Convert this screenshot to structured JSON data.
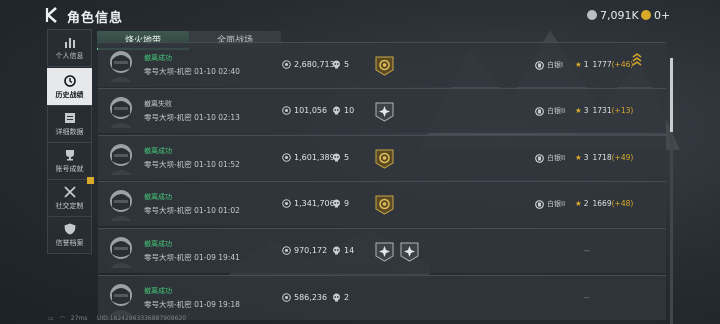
{
  "header": {
    "title": "角色信息",
    "currency_primary": "7,091K",
    "currency_secondary": "0+"
  },
  "sidebar": [
    {
      "label": "个人信息",
      "icon": "bar-chart-icon",
      "active": false
    },
    {
      "label": "历史战绩",
      "icon": "history-icon",
      "active": true
    },
    {
      "label": "详细数据",
      "icon": "document-icon",
      "active": false
    },
    {
      "label": "账号成就",
      "icon": "trophy-icon",
      "active": false
    },
    {
      "label": "社交定制",
      "icon": "tools-icon",
      "active": false,
      "badge": true
    },
    {
      "label": "信誉档案",
      "icon": "shield-icon",
      "active": false
    }
  ],
  "tabs": [
    {
      "label": "烽火地带",
      "active": true
    },
    {
      "label": "全面战场",
      "active": false
    }
  ],
  "records": [
    {
      "status": "撤离成功",
      "map": "零号大坝-机密",
      "time": "01-10 02:40",
      "money": "2,680,713",
      "kills": "5",
      "medals": [
        "gold-medal-icon"
      ],
      "rank": "白银I",
      "stars": "1",
      "score": "1777",
      "delta": "(+46)"
    },
    {
      "status": "撤离失败",
      "map": "零号大坝-机密",
      "time": "01-10 02:13",
      "money": "101,056",
      "kills": "10",
      "medals": [
        "silver-medal-icon"
      ],
      "rank": "白银II",
      "stars": "3",
      "score": "1731",
      "delta": "(+13)"
    },
    {
      "status": "撤离成功",
      "map": "零号大坝-机密",
      "time": "01-10 01:52",
      "money": "1,601,389",
      "kills": "5",
      "medals": [
        "gold-medal-icon"
      ],
      "rank": "白银II",
      "stars": "3",
      "score": "1718",
      "delta": "(+49)"
    },
    {
      "status": "撤离成功",
      "map": "零号大坝-机密",
      "time": "01-10 01:02",
      "money": "1,341,706",
      "kills": "9",
      "medals": [
        "gold-medal-icon"
      ],
      "rank": "白银II",
      "stars": "2",
      "score": "1669",
      "delta": "(+48)"
    },
    {
      "status": "撤离成功",
      "map": "零号大坝-机密",
      "time": "01-09 19:41",
      "money": "970,172",
      "kills": "14",
      "medals": [
        "silver-medal-icon",
        "silver-medal-icon"
      ],
      "dash": "--"
    },
    {
      "status": "撤离成功",
      "map": "零号大坝-机密",
      "time": "01-09 19:18",
      "money": "586,236",
      "kills": "2",
      "medals": [],
      "dash": "--"
    }
  ],
  "footer": {
    "ping": "27ms",
    "uid": "UID:18242963336887909620"
  },
  "colors": {
    "success": "#45c97a",
    "fail": "#c8cdd0",
    "delta": "#d9a92a",
    "active_tab_accent": "#6bd39b"
  }
}
